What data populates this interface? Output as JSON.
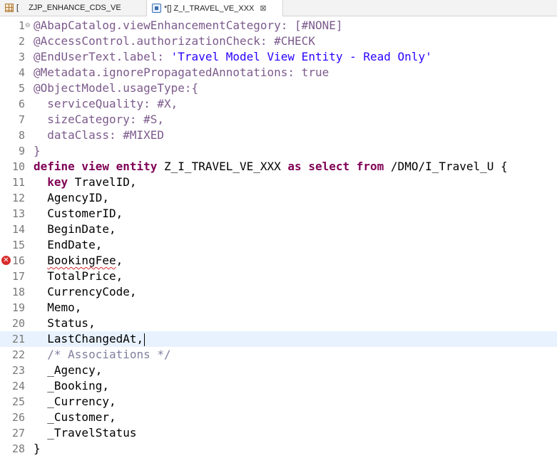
{
  "tabs": [
    {
      "prefix": "[",
      "label": "ZJP_ENHANCE_CDS_VE",
      "icon": "ddl-grid-icon"
    },
    {
      "prefix": "*[",
      "label": "] Z_I_TRAVEL_VE_XXX",
      "icon": "ddl-source-icon",
      "close": "⊠"
    }
  ],
  "code": [
    {
      "n": "1",
      "fold": "⊖",
      "parts": [
        {
          "c": "c-ann",
          "t": "@AbapCatalog.viewEnhancementCategory: [#NONE]"
        }
      ]
    },
    {
      "n": "2",
      "parts": [
        {
          "c": "c-ann",
          "t": "@AccessControl.authorizationCheck: #CHECK"
        }
      ]
    },
    {
      "n": "3",
      "parts": [
        {
          "c": "c-ann",
          "t": "@EndUserText.label: "
        },
        {
          "c": "c-str",
          "t": "'Travel Model View Entity - Read Only'"
        }
      ]
    },
    {
      "n": "4",
      "parts": [
        {
          "c": "c-ann",
          "t": "@Metadata.ignorePropagatedAnnotations: true"
        }
      ]
    },
    {
      "n": "5",
      "parts": [
        {
          "c": "c-ann",
          "t": "@ObjectModel.usageType:{"
        }
      ]
    },
    {
      "n": "6",
      "parts": [
        {
          "c": "c-ann",
          "t": "  serviceQuality: #X,"
        }
      ]
    },
    {
      "n": "7",
      "parts": [
        {
          "c": "c-ann",
          "t": "  sizeCategory: #S,"
        }
      ]
    },
    {
      "n": "8",
      "parts": [
        {
          "c": "c-ann",
          "t": "  dataClass: #MIXED"
        }
      ]
    },
    {
      "n": "9",
      "parts": [
        {
          "c": "c-ann",
          "t": "}"
        }
      ]
    },
    {
      "n": "10",
      "parts": [
        {
          "c": "c-kw",
          "t": "define view entity "
        },
        {
          "c": "c-id",
          "t": "Z_I_TRAVEL_VE_XXX "
        },
        {
          "c": "c-kw",
          "t": "as select from "
        },
        {
          "c": "c-id",
          "t": "/DMO/I_Travel_U {"
        }
      ]
    },
    {
      "n": "11",
      "parts": [
        {
          "c": "c-kw",
          "t": "  key "
        },
        {
          "c": "c-id",
          "t": "TravelID,"
        }
      ]
    },
    {
      "n": "12",
      "parts": [
        {
          "c": "c-id",
          "t": "  AgencyID,"
        }
      ]
    },
    {
      "n": "13",
      "parts": [
        {
          "c": "c-id",
          "t": "  CustomerID,"
        }
      ]
    },
    {
      "n": "14",
      "parts": [
        {
          "c": "c-id",
          "t": "  BeginDate,"
        }
      ]
    },
    {
      "n": "15",
      "parts": [
        {
          "c": "c-id",
          "t": "  EndDate,"
        }
      ]
    },
    {
      "n": "16",
      "error": "✕",
      "parts": [
        {
          "c": "c-id",
          "t": "  "
        },
        {
          "c": "c-id squig",
          "t": "BookingFee"
        },
        {
          "c": "c-id",
          "t": ","
        }
      ]
    },
    {
      "n": "17",
      "parts": [
        {
          "c": "c-id",
          "t": "  TotalPrice,"
        }
      ]
    },
    {
      "n": "18",
      "parts": [
        {
          "c": "c-id",
          "t": "  CurrencyCode,"
        }
      ]
    },
    {
      "n": "19",
      "parts": [
        {
          "c": "c-id",
          "t": "  Memo,"
        }
      ]
    },
    {
      "n": "20",
      "parts": [
        {
          "c": "c-id",
          "t": "  Status,"
        }
      ]
    },
    {
      "n": "21",
      "current": true,
      "parts": [
        {
          "c": "c-id",
          "t": "  LastChangedAt,"
        }
      ]
    },
    {
      "n": "22",
      "parts": [
        {
          "c": "c-cmt",
          "t": "  /* Associations */"
        }
      ]
    },
    {
      "n": "23",
      "parts": [
        {
          "c": "c-id",
          "t": "  _Agency,"
        }
      ]
    },
    {
      "n": "24",
      "parts": [
        {
          "c": "c-id",
          "t": "  _Booking,"
        }
      ]
    },
    {
      "n": "25",
      "parts": [
        {
          "c": "c-id",
          "t": "  _Currency,"
        }
      ]
    },
    {
      "n": "26",
      "parts": [
        {
          "c": "c-id",
          "t": "  _Customer,"
        }
      ]
    },
    {
      "n": "27",
      "parts": [
        {
          "c": "c-id",
          "t": "  _TravelStatus"
        }
      ]
    },
    {
      "n": "28",
      "parts": [
        {
          "c": "c-id",
          "t": "}"
        }
      ]
    }
  ]
}
